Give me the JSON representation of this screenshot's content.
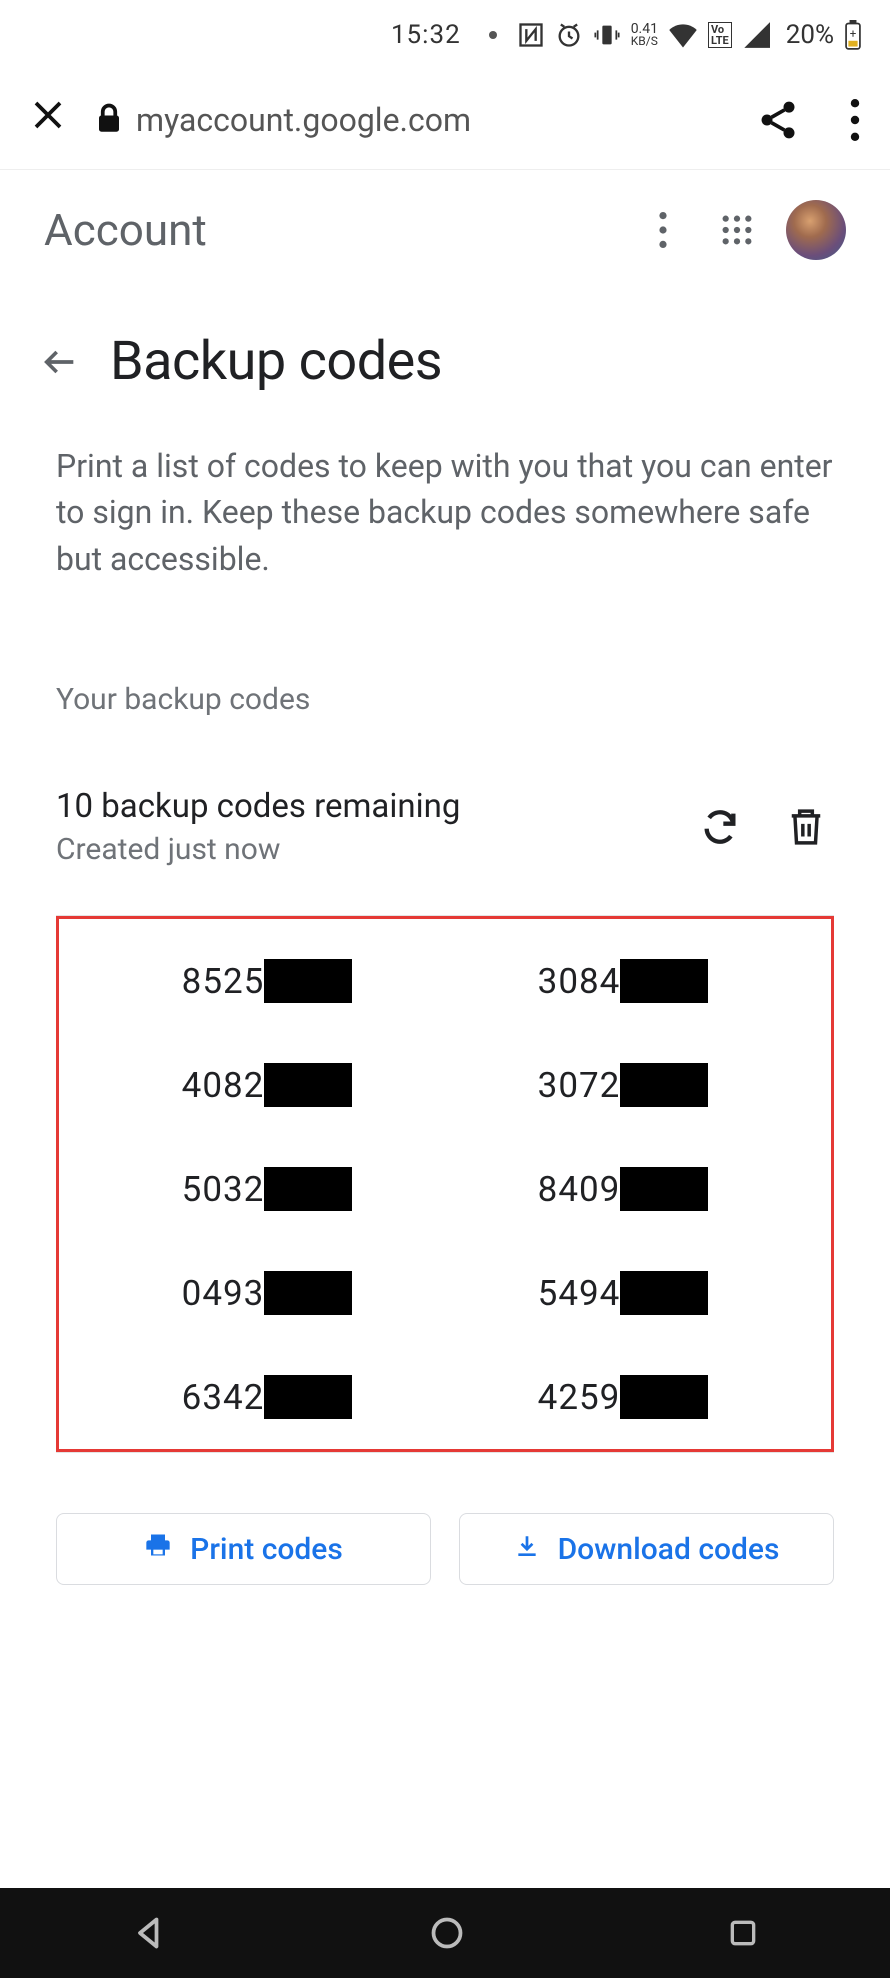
{
  "status": {
    "time": "15:32",
    "net_speed_top": "0.41",
    "net_speed_bottom": "KB/S",
    "battery_pct": "20%"
  },
  "browser": {
    "url": "myaccount.google.com"
  },
  "header": {
    "account_label": "Account"
  },
  "page": {
    "title": "Backup codes",
    "description": "Print a list of codes to keep with you that you can enter to sign in. Keep these backup codes some­where safe but accessible.",
    "section_label": "Your backup codes",
    "remaining": "10 backup codes remaining",
    "created": "Created just now"
  },
  "codes": {
    "left": [
      "8525",
      "4082",
      "5032",
      "0493",
      "6342"
    ],
    "right": [
      "3084",
      "3072",
      "8409",
      "5494",
      "4259"
    ]
  },
  "actions": {
    "print": "Print codes",
    "download": "Download codes"
  }
}
